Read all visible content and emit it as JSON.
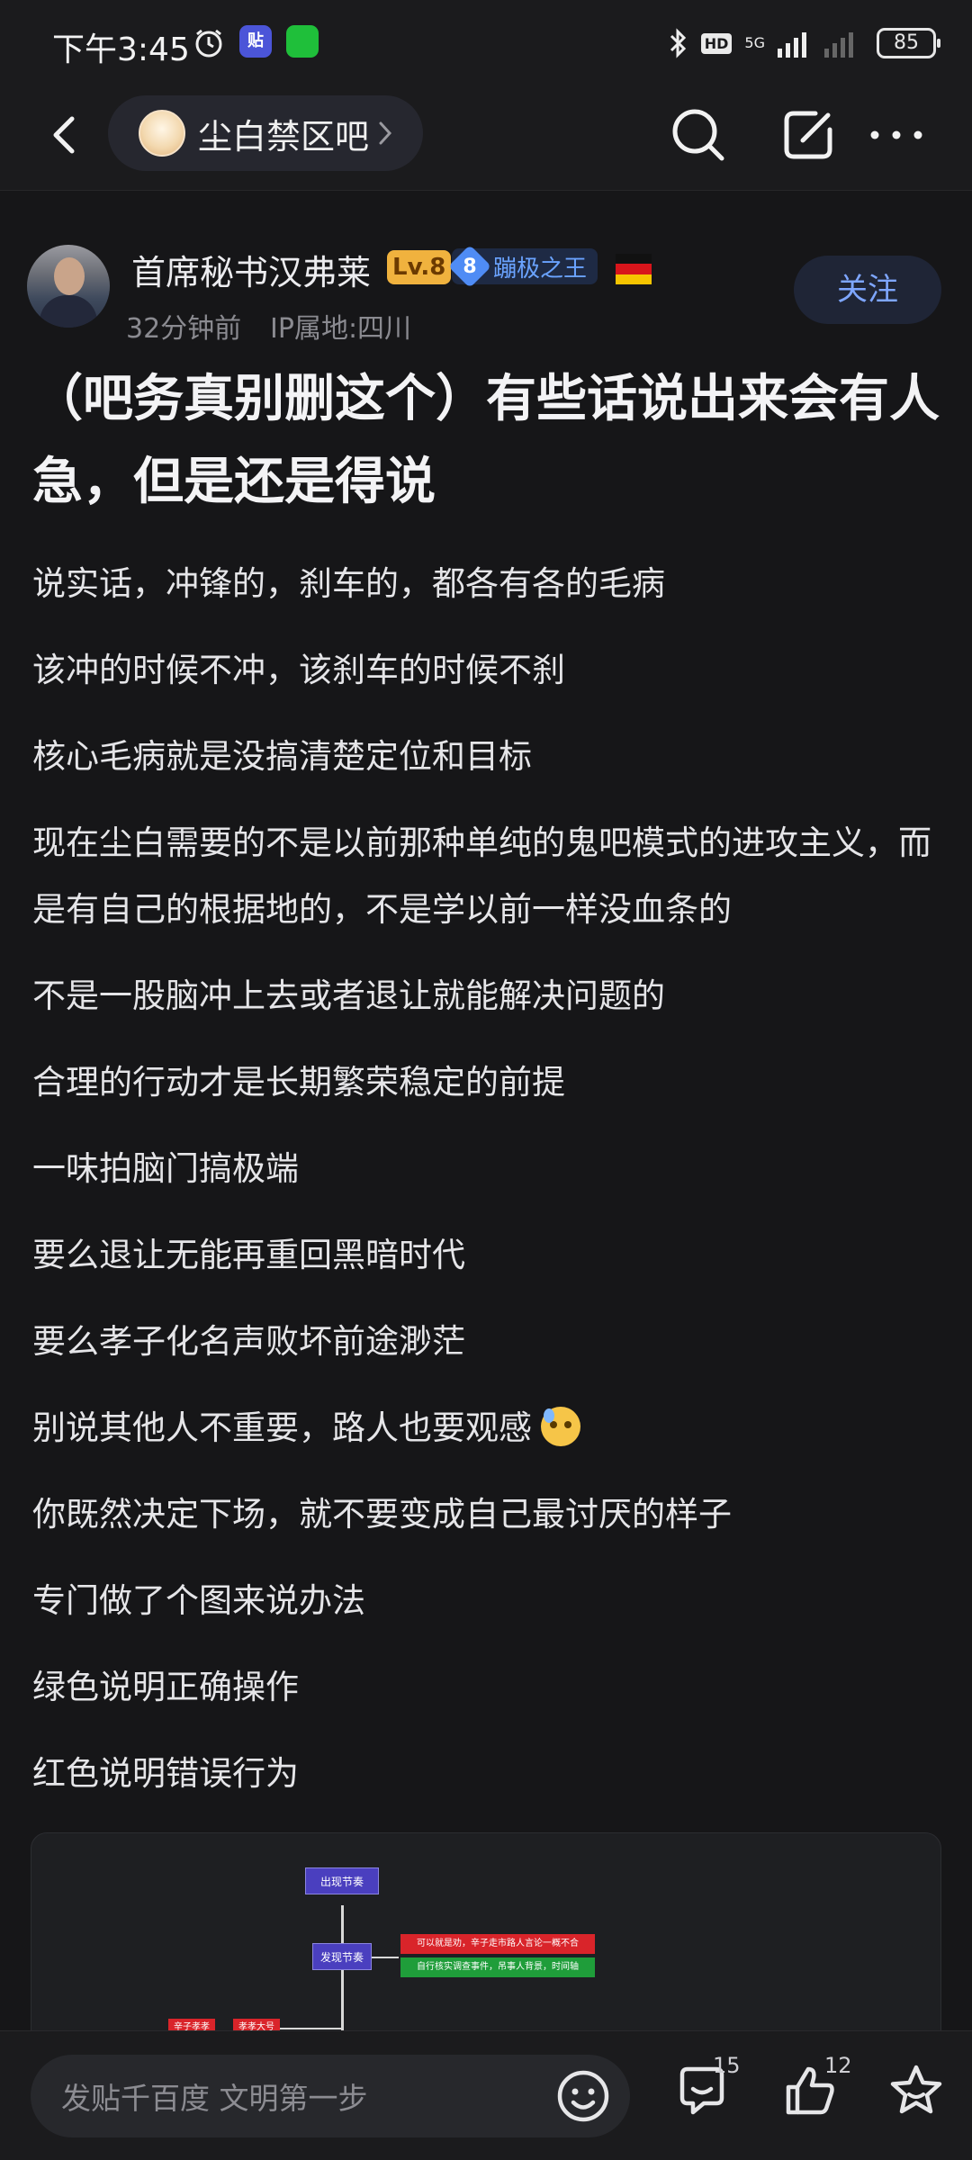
{
  "status_bar": {
    "time": "下午3:45",
    "network": "5G",
    "hd": "HD",
    "battery": "85",
    "app_badge": "贴"
  },
  "nav": {
    "forum_name": "尘白禁区吧"
  },
  "author": {
    "name": "首席秘书汉弗莱",
    "level": "Lv.8",
    "honor_level": "8",
    "honor_title": "蹦极之王",
    "time_ago": "32分钟前",
    "ip_location": "IP属地:四川",
    "follow_label": "关注"
  },
  "post": {
    "title": "（吧务真别删这个）有些话说出来会有人急，但是还是得说",
    "paragraphs": [
      "说实话，冲锋的，刹车的，都各有各的毛病",
      "该冲的时候不冲，该刹车的时候不刹",
      "核心毛病就是没搞清楚定位和目标",
      "现在尘白需要的不是以前那种单纯的鬼吧模式的进攻主义，而是有自己的根据地的，不是学以前一样没血条的",
      "不是一股脑冲上去或者退让就能解决问题的",
      "合理的行动才是长期繁荣稳定的前提",
      "一味拍脑门搞极端",
      "要么退让无能再重回黑暗时代",
      "要么孝子化名声败坏前途渺茫",
      "别说其他人不重要，路人也要观感",
      "你既然决定下场，就不要变成自己最讨厌的样子",
      "专门做了个图来说办法",
      "绿色说明正确操作",
      "红色说明错误行为"
    ]
  },
  "image": {
    "node_top": "出现节奏",
    "node_mid": "发现节奏",
    "note_red": "可以就是劝，辛子走市路人言论一概不合",
    "note_green": "自行核实调查事件，吊事人背景，时间轴",
    "node_left_1": "辛子孝孝",
    "node_left_2": "孝孝大号"
  },
  "bottom_bar": {
    "comment_placeholder": "发贴千百度 文明第一步",
    "comment_count": "15",
    "like_count": "12"
  },
  "colors": {
    "background": "#161618",
    "bar": "#1b1b1d",
    "accent_blue": "#7ea6ff",
    "level_gold": "#f0b23e",
    "image_red": "#d9242a",
    "image_green": "#1f9d3a",
    "image_purple": "#4a3fbf"
  },
  "icons": [
    "back-icon",
    "chevron-right-icon",
    "search-icon",
    "edit-share-icon",
    "more-icon",
    "emoji-icon",
    "comment-icon",
    "like-icon",
    "star-icon",
    "alarm-icon",
    "bluetooth-icon",
    "signal-icon"
  ]
}
